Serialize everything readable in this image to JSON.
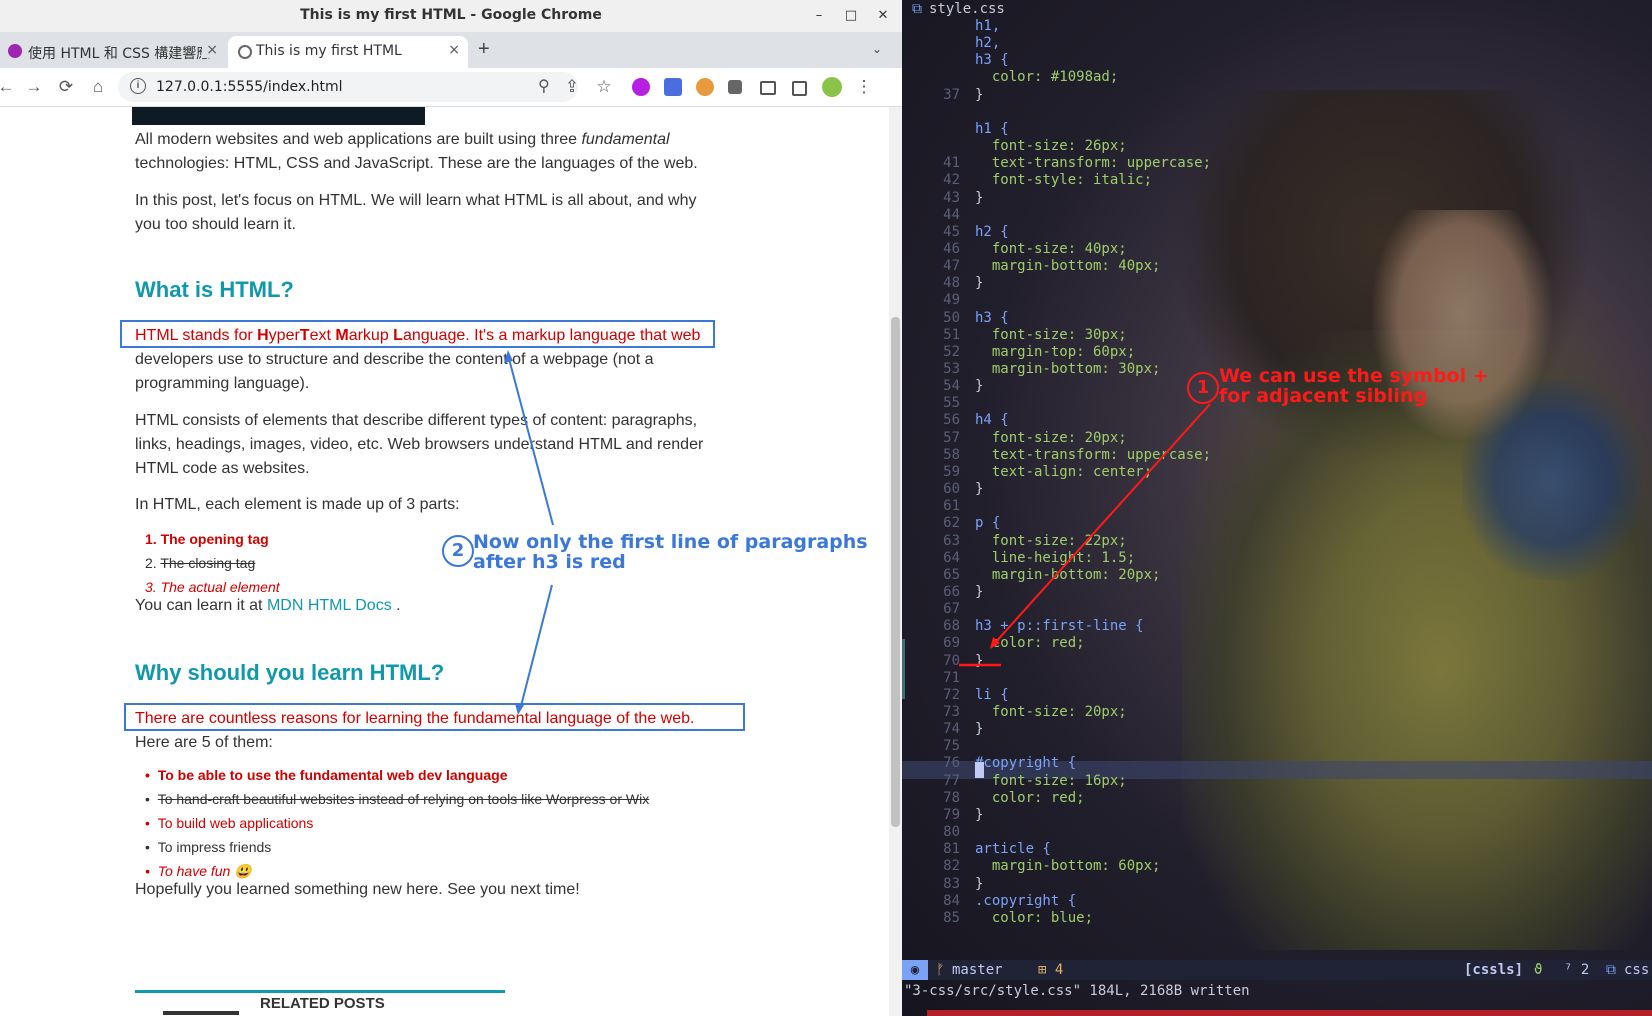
{
  "window": {
    "title": "This is my first HTML - Google Chrome",
    "min": "–",
    "max": "□",
    "close": "✕"
  },
  "tabs": [
    {
      "label": "使用 HTML 和 CSS 構建響應",
      "close": "×"
    },
    {
      "label": "This is my first HTML",
      "close": "×"
    }
  ],
  "new_tab": "+",
  "tab_menu": "⌄",
  "toolbar": {
    "back": "←",
    "forward": "→",
    "reload": "⟳",
    "home": "⌂",
    "info": "i",
    "url": "127.0.0.1:5555/index.html",
    "zoom": "⚲",
    "share": "⇪",
    "star": "☆",
    "menu": "⋮"
  },
  "article": {
    "p1_a": "All modern websites and web applications are built using three ",
    "p1_em": "fundamental",
    "p1_b": " technologies: HTML, CSS and JavaScript. These are the languages of the web.",
    "p2": "In this post, let's focus on HTML. We will learn what HTML is all about, and why you too should learn it.",
    "h3_1": "What is HTML?",
    "p3_l1_a": "HTML stands for ",
    "p3_H": "H",
    "p3_yper": "yper",
    "p3_T": "T",
    "p3_ext": "ext ",
    "p3_M": "M",
    "p3_arkup": "arkup ",
    "p3_L": "L",
    "p3_l1_b": "anguage. It's a markup language that web",
    "p3_rest": "developers use to structure and describe the content of a webpage (not a programming language).",
    "p4": "HTML consists of elements that describe different types of content: paragraphs, links, headings, images, video, etc. Web browsers understand HTML and render HTML code as websites.",
    "p5": "In HTML, each element is made up of 3 parts:",
    "parts": [
      "The opening tag",
      "The closing tag",
      "The actual element"
    ],
    "learn_prefix": "You can learn it at ",
    "learn_link": "MDN HTML Docs",
    "learn_suffix": " .",
    "h3_2": "Why should you learn HTML?",
    "p6_l1": "There are countless reasons for learning the fundamental language of the web.",
    "p6_rest": "Here are 5 of them:",
    "reasons": [
      "To be able to use the fundamental web dev language",
      "To hand-craft beautiful websites instead of relying on tools like Worpress or Wix",
      "To build web applications",
      "To impress friends",
      "To have fun 😃"
    ],
    "closing": "Hopefully you learned something new here. See you next time!",
    "related": "RELATED POSTS"
  },
  "annotations": {
    "one_num": "1",
    "one_l1": "We can use the symbol +",
    "one_l2": "for adjacent sibling",
    "two_num": "2",
    "two_l1": "Now only the first line of paragraphs",
    "two_l2": "after h3 is red"
  },
  "editor": {
    "filename": "style.css",
    "lines": [
      {
        "n": "",
        "t": "h1,"
      },
      {
        "n": "",
        "t": "h2,"
      },
      {
        "n": "",
        "t": "h3 {"
      },
      {
        "n": "",
        "t": "  color: #1098ad;"
      },
      {
        "n": "37",
        "t": "}"
      },
      {
        "n": "",
        "t": ""
      },
      {
        "n": "",
        "t": "h1 {"
      },
      {
        "n": "",
        "t": "  font-size: 26px;"
      },
      {
        "n": "41",
        "t": "  text-transform: uppercase;"
      },
      {
        "n": "42",
        "t": "  font-style: italic;"
      },
      {
        "n": "43",
        "t": "}"
      },
      {
        "n": "44",
        "t": ""
      },
      {
        "n": "45",
        "t": "h2 {"
      },
      {
        "n": "46",
        "t": "  font-size: 40px;"
      },
      {
        "n": "47",
        "t": "  margin-bottom: 40px;"
      },
      {
        "n": "48",
        "t": "}"
      },
      {
        "n": "49",
        "t": ""
      },
      {
        "n": "50",
        "t": "h3 {"
      },
      {
        "n": "51",
        "t": "  font-size: 30px;"
      },
      {
        "n": "52",
        "t": "  margin-top: 60px;"
      },
      {
        "n": "53",
        "t": "  margin-bottom: 30px;"
      },
      {
        "n": "54",
        "t": "}"
      },
      {
        "n": "55",
        "t": ""
      },
      {
        "n": "56",
        "t": "h4 {"
      },
      {
        "n": "57",
        "t": "  font-size: 20px;"
      },
      {
        "n": "58",
        "t": "  text-transform: uppercase;"
      },
      {
        "n": "59",
        "t": "  text-align: center;"
      },
      {
        "n": "60",
        "t": "}"
      },
      {
        "n": "61",
        "t": ""
      },
      {
        "n": "62",
        "t": "p {"
      },
      {
        "n": "63",
        "t": "  font-size: 22px;"
      },
      {
        "n": "64",
        "t": "  line-height: 1.5;"
      },
      {
        "n": "65",
        "t": "  margin-bottom: 20px;"
      },
      {
        "n": "66",
        "t": "}"
      },
      {
        "n": "67",
        "t": ""
      },
      {
        "n": "68",
        "t": "h3 + p::first-line {"
      },
      {
        "n": "69",
        "t": "  color: red;"
      },
      {
        "n": "70",
        "t": "}"
      },
      {
        "n": "71",
        "t": ""
      },
      {
        "n": "72",
        "t": "li {"
      },
      {
        "n": "73",
        "t": "  font-size: 20px;"
      },
      {
        "n": "74",
        "t": "}"
      },
      {
        "n": "75",
        "t": ""
      },
      {
        "n": "76",
        "t": "#copyright {"
      },
      {
        "n": "77",
        "t": "  font-size: 16px;"
      },
      {
        "n": "78",
        "t": "  color: red;"
      },
      {
        "n": "79",
        "t": "}"
      },
      {
        "n": "80",
        "t": ""
      },
      {
        "n": "81",
        "t": "article {"
      },
      {
        "n": "82",
        "t": "  margin-bottom: 60px;"
      },
      {
        "n": "83",
        "t": "}"
      },
      {
        "n": "84",
        "t": ".copyright {"
      },
      {
        "n": "85",
        "t": "  color: blue;"
      }
    ],
    "status": {
      "mode": "◉",
      "branch_icon": "ᚠ",
      "branch": "master",
      "changes": "⊞ 4",
      "lsp": "[cssls]",
      "lsp_icon": "ϑ",
      "count": "⁷ 2",
      "ft_icon": "⧉",
      "filetype": "css"
    },
    "cmdline": "\"3-css/src/style.css\" 184L, 2168B written"
  }
}
